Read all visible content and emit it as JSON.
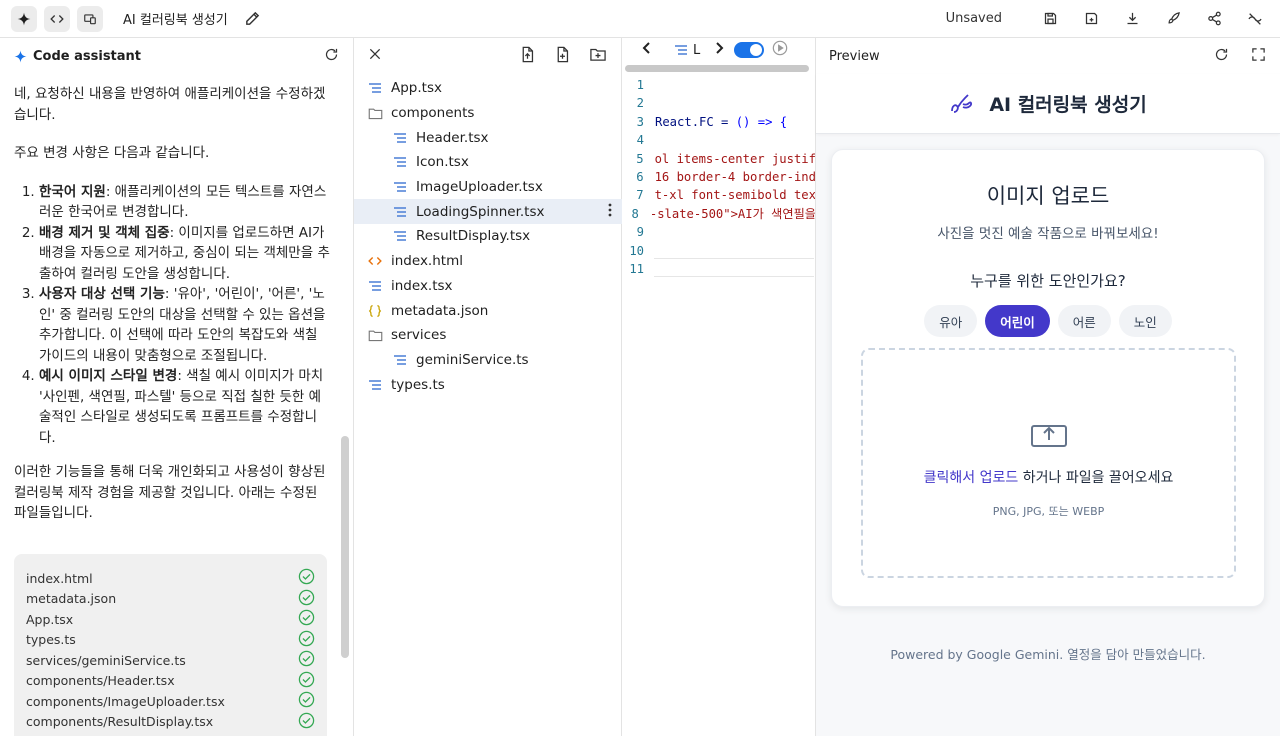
{
  "topbar": {
    "app_title": "AI 컬러링북 생성기",
    "status": "Unsaved"
  },
  "chat": {
    "title": "Code assistant",
    "intro": "네, 요청하신 내용을 반영하여 애플리케이션을 수정하겠습니다.",
    "changes_heading": "주요 변경 사항은 다음과 같습니다.",
    "items": [
      {
        "bold": "한국어 지원",
        "text": ": 애플리케이션의 모든 텍스트를 자연스러운 한국어로 변경합니다."
      },
      {
        "bold": "배경 제거 및 객체 집중",
        "text": ": 이미지를 업로드하면 AI가 배경을 자동으로 제거하고, 중심이 되는 객체만을 추출하여 컬러링 도안을 생성합니다."
      },
      {
        "bold": "사용자 대상 선택 기능",
        "text": ": '유아', '어린이', '어른', '노인' 중 컬러링 도안의 대상을 선택할 수 있는 옵션을 추가합니다. 이 선택에 따라 도안의 복잡도와 색칠 가이드의 내용이 맞춤형으로 조절됩니다."
      },
      {
        "bold": "예시 이미지 스타일 변경",
        "text": ": 색칠 예시 이미지가 마치 '사인펜, 색연필, 파스텔' 등으로 직접 칠한 듯한 예술적인 스타일로 생성되도록 프롬프트를 수정합니다."
      }
    ],
    "outro": "이러한 기능들을 통해 더욱 개인화되고 사용성이 향상된 컬러링북 제작 경험을 제공할 것입니다. 아래는 수정된 파일들입니다.",
    "changed_files": [
      "index.html",
      "metadata.json",
      "App.tsx",
      "types.ts",
      "services/geminiService.ts",
      "components/Header.tsx",
      "components/ImageUploader.tsx",
      "components/ResultDisplay.tsx"
    ]
  },
  "tree": {
    "items": [
      {
        "label": "App.tsx",
        "icon": "lines",
        "depth": 0
      },
      {
        "label": "components",
        "icon": "folder",
        "depth": 0
      },
      {
        "label": "Header.tsx",
        "icon": "lines",
        "depth": 1
      },
      {
        "label": "Icon.tsx",
        "icon": "lines",
        "depth": 1
      },
      {
        "label": "ImageUploader.tsx",
        "icon": "lines",
        "depth": 1
      },
      {
        "label": "LoadingSpinner.tsx",
        "icon": "lines",
        "depth": 1,
        "selected": true
      },
      {
        "label": "ResultDisplay.tsx",
        "icon": "lines",
        "depth": 1
      },
      {
        "label": "index.html",
        "icon": "code",
        "depth": 0
      },
      {
        "label": "index.tsx",
        "icon": "lines",
        "depth": 0
      },
      {
        "label": "metadata.json",
        "icon": "braces",
        "depth": 0
      },
      {
        "label": "services",
        "icon": "folder",
        "depth": 0
      },
      {
        "label": "geminiService.ts",
        "icon": "lines",
        "depth": 1
      },
      {
        "label": "types.ts",
        "icon": "lines",
        "depth": 0
      }
    ]
  },
  "editor": {
    "tab_label": "L",
    "lines": [
      {
        "n": "1",
        "segs": []
      },
      {
        "n": "2",
        "segs": []
      },
      {
        "n": "3",
        "segs": [
          {
            "t": "React",
            "c": "plain"
          },
          {
            "t": ".FC = ",
            "c": "plain"
          },
          {
            "t": "() => {",
            "c": "kw"
          }
        ]
      },
      {
        "n": "4",
        "segs": []
      },
      {
        "n": "5",
        "segs": [
          {
            "t": "ol items-center justif",
            "c": "ctext"
          }
        ]
      },
      {
        "n": "6",
        "segs": [
          {
            "t": "16 border-4 border-ind",
            "c": "ctext"
          }
        ]
      },
      {
        "n": "7",
        "segs": [
          {
            "t": "t-xl font-semibold tex",
            "c": "ctext"
          }
        ]
      },
      {
        "n": "8",
        "segs": [
          {
            "t": "-slate-500\">AI가 색연필을",
            "c": "ctext"
          }
        ]
      },
      {
        "n": "9",
        "segs": []
      },
      {
        "n": "10",
        "segs": []
      },
      {
        "n": "11",
        "segs": []
      }
    ]
  },
  "preview": {
    "title": "Preview",
    "app_name": "AI 컬러링북 생성기",
    "upload_title": "이미지 업로드",
    "upload_subtitle": "사진을 멋진 예술 작품으로 바꿔보세요!",
    "audience_question": "누구를 위한 도안인가요?",
    "audiences": [
      "유아",
      "어린이",
      "어른",
      "노인"
    ],
    "selected_audience": "어린이",
    "dropzone_link": "클릭해서 업로드",
    "dropzone_text": " 하거나 파일을 끌어오세요",
    "dropzone_hint": "PNG, JPG, 또는 WEBP",
    "footer": "Powered by Google Gemini. 열정을 담아 만들었습니다.",
    "accent_color": "#4338ca"
  }
}
